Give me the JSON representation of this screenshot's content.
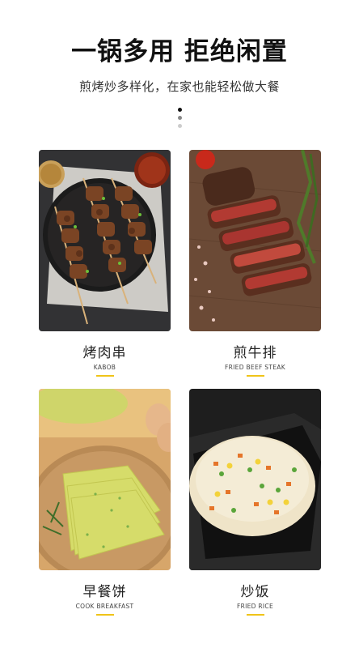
{
  "header": {
    "title": "一锅多用 拒绝闲置",
    "subtitle": "煎烤炒多样化，在家也能轻松做大餐"
  },
  "pagination": {
    "total": 3,
    "active": 1
  },
  "colors": {
    "accent": "#f0c419",
    "title": "#111111"
  },
  "dishes": [
    {
      "cn": "烤肉串",
      "en": "KABOB",
      "image": "kabob-photo"
    },
    {
      "cn": "煎牛排",
      "en": "FRIED BEEF STEAK",
      "image": "steak-photo"
    },
    {
      "cn": "早餐饼",
      "en": "COOK BREAKFAST",
      "image": "pancake-photo"
    },
    {
      "cn": "炒饭",
      "en": "FRIED RICE",
      "image": "fried-rice-photo"
    }
  ]
}
